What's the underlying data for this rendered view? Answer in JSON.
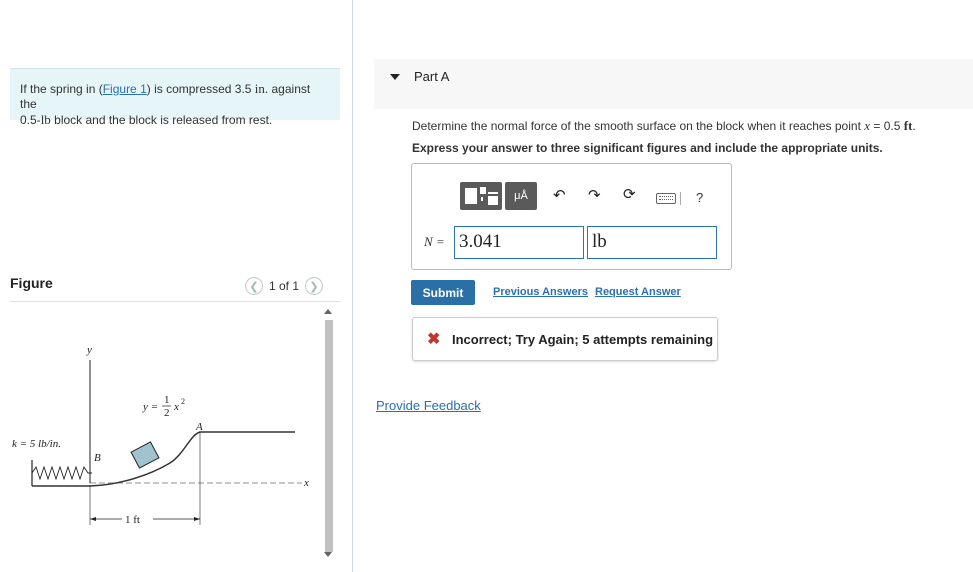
{
  "problem": {
    "text_before_link": "If the spring in (",
    "link": "Figure 1",
    "text_after_link": ") is compressed 3.5 ",
    "unit_in": "in.",
    "text_mid": " against the",
    "line2_weight": "0.5-",
    "unit_lb": "lb",
    "line2_rest": " block and the block is released from rest."
  },
  "figure": {
    "label": "Figure",
    "pager": "1 of 1",
    "prev_icon": "chevron-left-icon",
    "next_icon": "chevron-right-icon",
    "labels": {
      "y_axis": "y",
      "x_axis": "x",
      "k": "k = 5 lb/in.",
      "b": "B",
      "a": "A",
      "eq_lhs": "y =",
      "eq_num": "1",
      "eq_den": "2",
      "eq_var": "x",
      "eq_exp": "2",
      "dim": "1 ft"
    }
  },
  "part": {
    "title": "Part A",
    "question_prefix": "Determine the normal force of the smooth surface on the block when it reaches point ",
    "question_var": "x",
    "question_eq": " = 0.5 ",
    "question_unit": "ft",
    "question_end": ".",
    "instruction": "Express your answer to three significant figures and include the appropriate units."
  },
  "toolbar": {
    "units_label": "μÅ",
    "help": "?",
    "icons": [
      "templates-icon",
      "units-icon",
      "undo-icon",
      "redo-icon",
      "reset-icon",
      "keyboard-icon",
      "help-icon"
    ]
  },
  "answer": {
    "label": "N =",
    "value": "3.041",
    "unit": "lb"
  },
  "actions": {
    "submit": "Submit",
    "previous": "Previous Answers",
    "request": "Request Answer"
  },
  "feedback": {
    "message": "Incorrect; Try Again; 5 attempts remaining",
    "color": "#c0392b"
  },
  "provide_feedback": "Provide Feedback",
  "colors": {
    "accent": "#2a6fa6",
    "link": "#2a6fb0",
    "problem_bg": "#e6f5f8",
    "block": "#9fc3cf"
  }
}
